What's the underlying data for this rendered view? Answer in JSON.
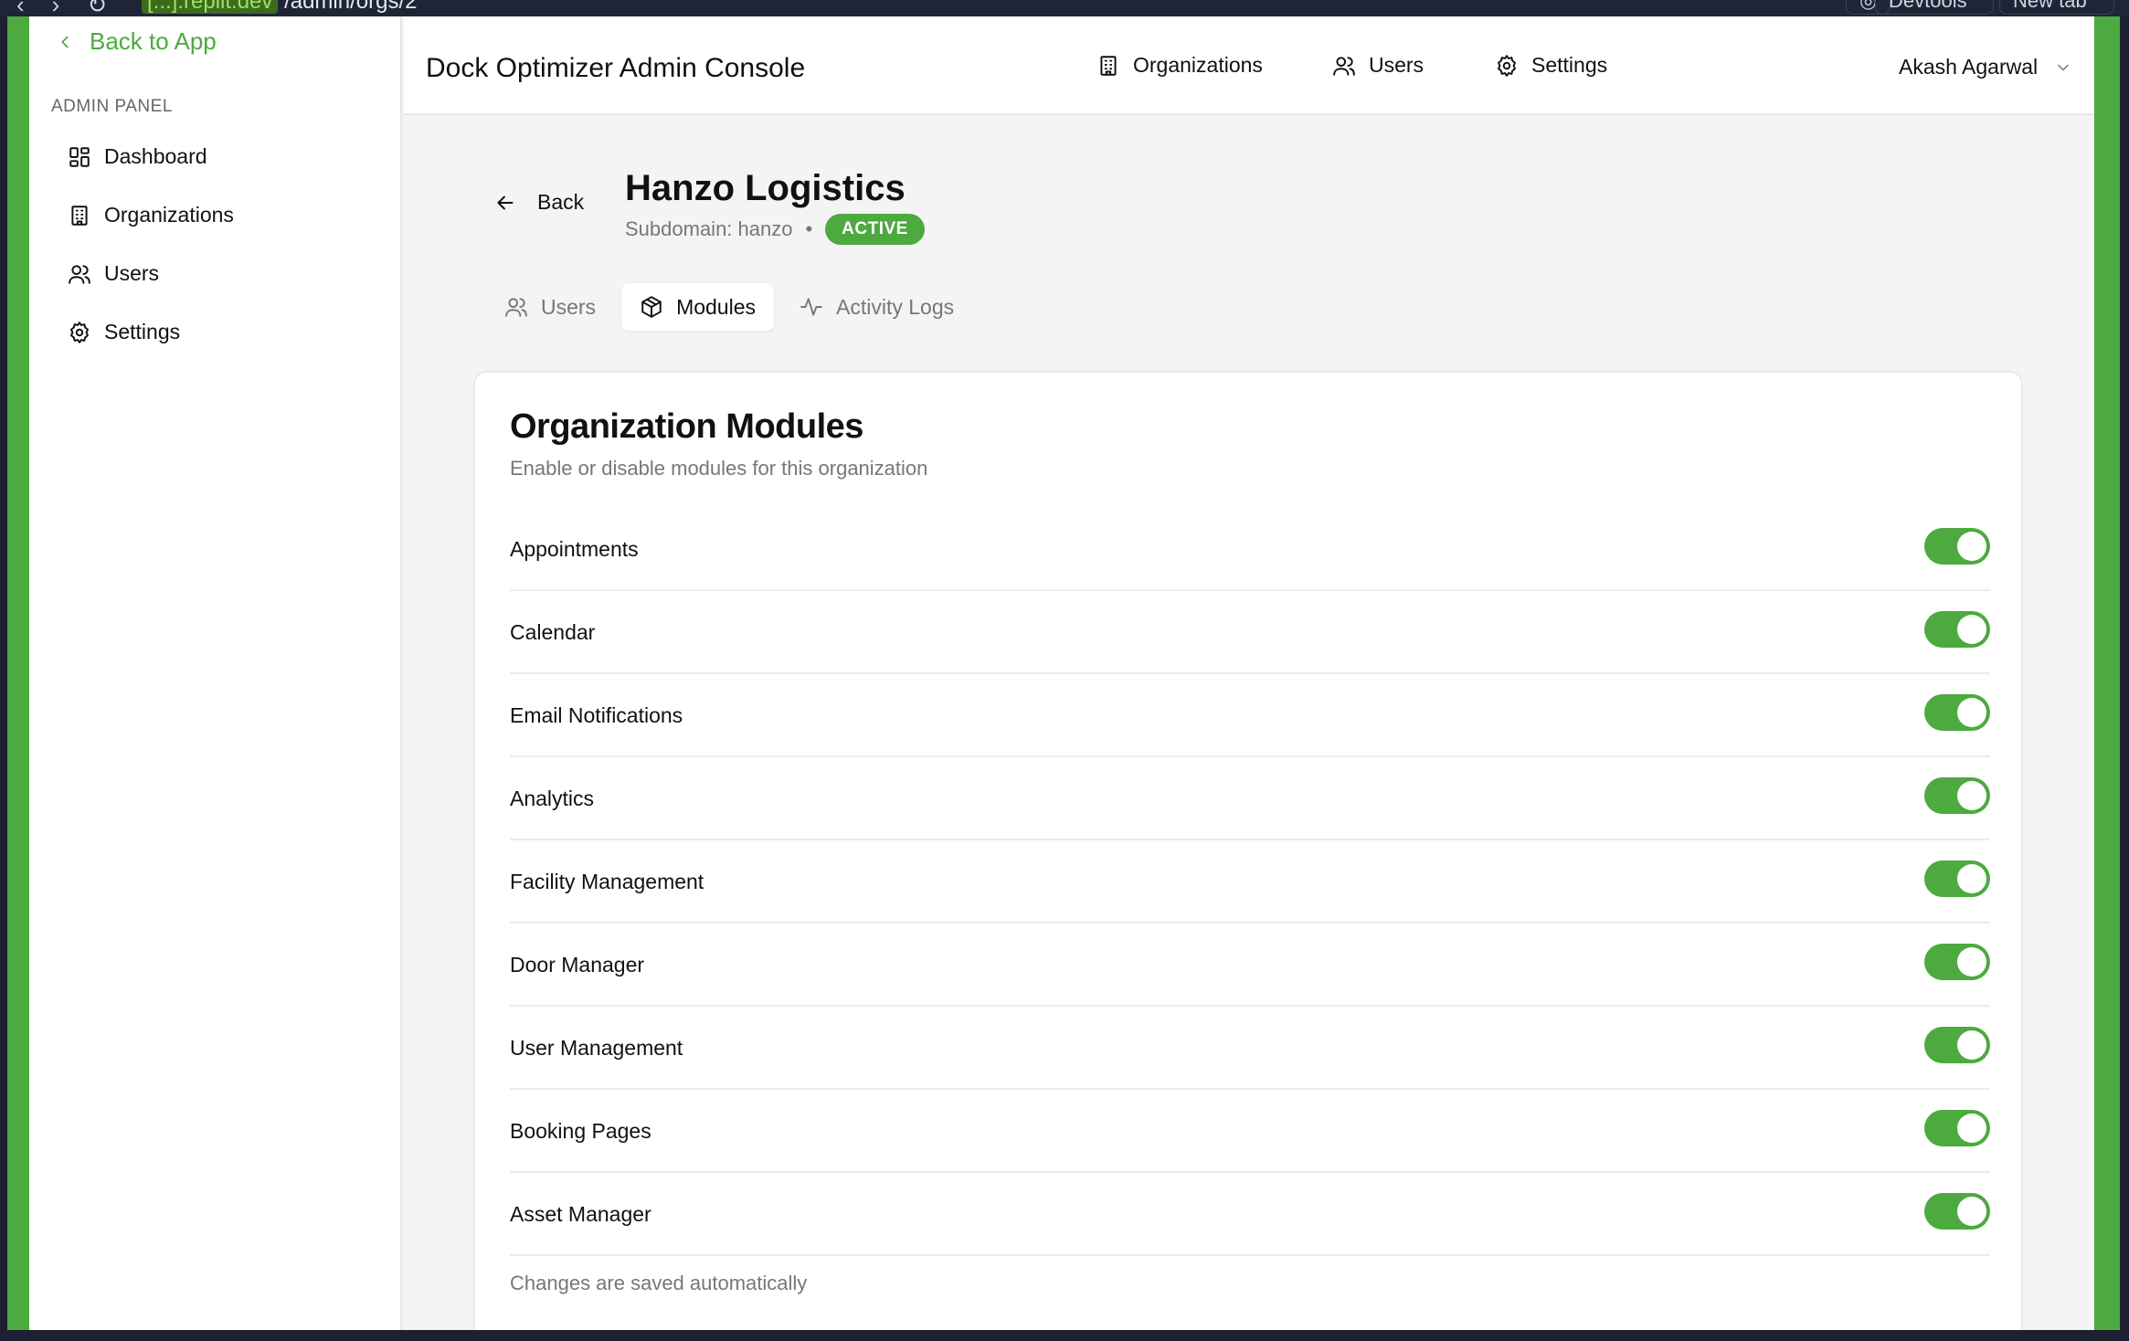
{
  "browser": {
    "url_host": "[...].replit.dev",
    "url_path": "/admin/orgs/2",
    "devtools_label": "Devtools",
    "new_tab_label": "New tab"
  },
  "sidebar": {
    "back_label": "Back to App",
    "section_label": "ADMIN PANEL",
    "items": [
      {
        "label": "Dashboard",
        "icon": "dashboard-icon"
      },
      {
        "label": "Organizations",
        "icon": "building-icon"
      },
      {
        "label": "Users",
        "icon": "users-icon"
      },
      {
        "label": "Settings",
        "icon": "gear-icon"
      }
    ]
  },
  "header": {
    "title": "Dock Optimizer Admin Console",
    "nav": [
      {
        "label": "Organizations",
        "icon": "building-icon"
      },
      {
        "label": "Users",
        "icon": "users-icon"
      },
      {
        "label": "Settings",
        "icon": "gear-icon"
      }
    ],
    "user_name": "Akash Agarwal"
  },
  "org": {
    "back_label": "Back",
    "name": "Hanzo Logistics",
    "subdomain_text": "Subdomain: hanzo",
    "separator": "•",
    "status": "ACTIVE"
  },
  "tabs": [
    {
      "label": "Users",
      "icon": "users-icon",
      "active": false
    },
    {
      "label": "Modules",
      "icon": "package-icon",
      "active": true
    },
    {
      "label": "Activity Logs",
      "icon": "activity-icon",
      "active": false
    }
  ],
  "modules_card": {
    "title": "Organization Modules",
    "description": "Enable or disable modules for this organization",
    "modules": [
      {
        "name": "Appointments",
        "enabled": true
      },
      {
        "name": "Calendar",
        "enabled": true
      },
      {
        "name": "Email Notifications",
        "enabled": true
      },
      {
        "name": "Analytics",
        "enabled": true
      },
      {
        "name": "Facility Management",
        "enabled": true
      },
      {
        "name": "Door Manager",
        "enabled": true
      },
      {
        "name": "User Management",
        "enabled": true
      },
      {
        "name": "Booking Pages",
        "enabled": true
      },
      {
        "name": "Asset Manager",
        "enabled": true
      }
    ],
    "footer_note": "Changes are saved automatically"
  },
  "colors": {
    "accent": "#4caa3e",
    "frame": "#4caa3e",
    "chrome": "#1e2536"
  }
}
